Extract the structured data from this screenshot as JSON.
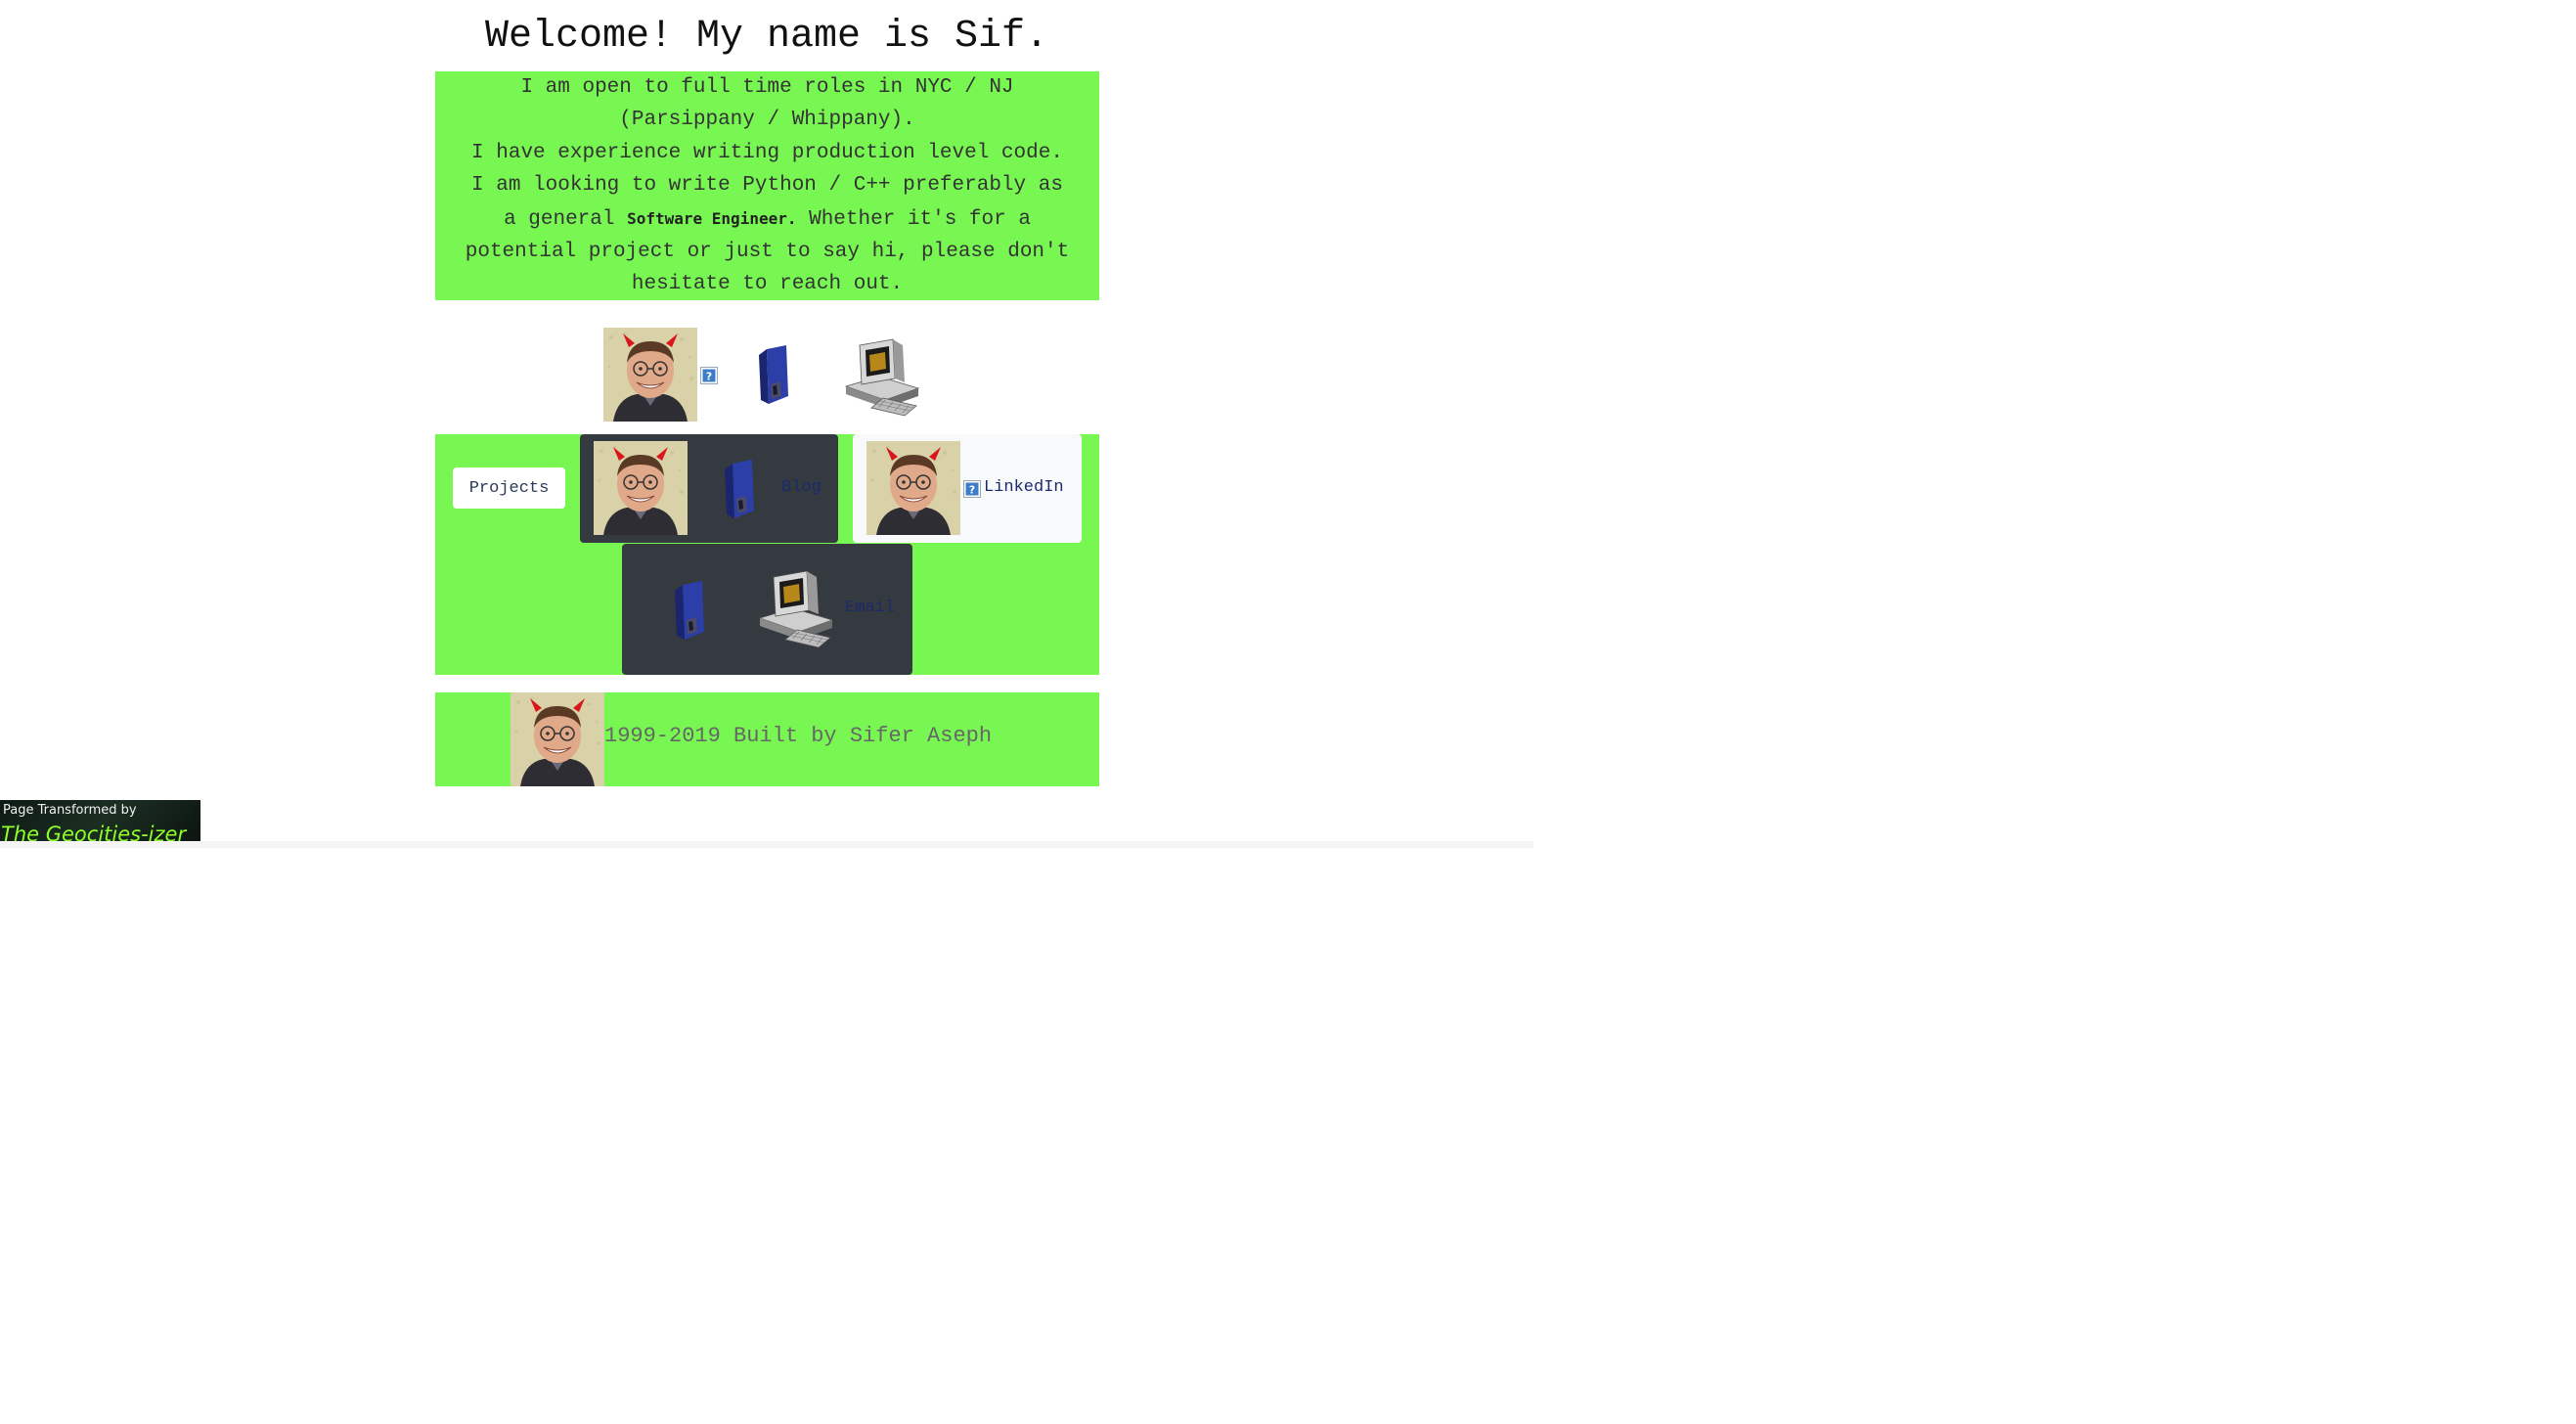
{
  "header": {
    "title": "Welcome! My name is Sif."
  },
  "intro": {
    "line1": "I am open to full time roles in NYC / NJ",
    "line2": "(Parsippany / Whippany).",
    "line3": "I have experience writing production level code.",
    "line4": "I am looking to write Python / C++ preferably as",
    "line5_pre": "a general ",
    "line5_highlight": "Software Engineer.",
    "line5_post": " Whether it's for a",
    "line6": "potential project or just to say hi, please don't",
    "line7": "hesitate to reach out."
  },
  "icons": {
    "row": [
      "portrait-icon",
      "broken-image-icon",
      "floppy-disk-icon",
      "computer-icon"
    ]
  },
  "nav": {
    "projects_label": "Projects",
    "blog_label": "Blog",
    "linkedin_label": "LinkedIn",
    "email_label": "Email"
  },
  "footer": {
    "text": "1999-2019 Built by Sifer Aseph"
  },
  "badge": {
    "line1": "Page Transformed by",
    "line2": "The Geocities-izer"
  },
  "colors": {
    "accent_green": "#78f752",
    "dark_button": "#343a40",
    "light_button": "#f8f9fa",
    "link_text": "#1b2a6b"
  }
}
